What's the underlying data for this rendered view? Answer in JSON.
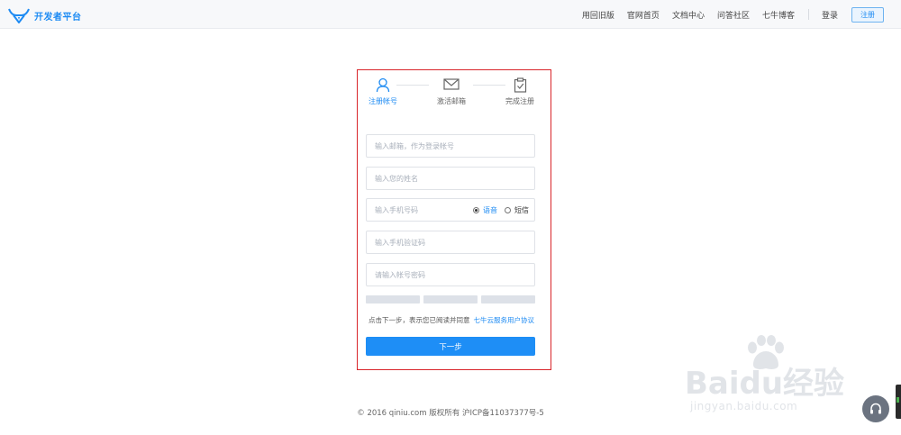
{
  "brand": {
    "name": "开发者平台",
    "color": "#1e8bf3"
  },
  "nav": {
    "items": [
      "用回旧版",
      "官网首页",
      "文档中心",
      "问答社区",
      "七牛博客"
    ],
    "login": "登录",
    "register": "注册"
  },
  "steps": [
    {
      "label": "注册帐号",
      "icon": "user-icon",
      "active": true
    },
    {
      "label": "激活邮箱",
      "icon": "mail-icon",
      "active": false
    },
    {
      "label": "完成注册",
      "icon": "clipboard-check-icon",
      "active": false
    }
  ],
  "form": {
    "email_placeholder": "输入邮箱，作为登录帐号",
    "name_placeholder": "输入您的姓名",
    "phone_placeholder": "输入手机号码",
    "verify_method": {
      "options": [
        "语音",
        "短信"
      ],
      "selected": "语音"
    },
    "code_placeholder": "输入手机验证码",
    "password_placeholder": "请输入帐号密码",
    "agree_text": "点击下一步，表示您已阅读并同意",
    "agree_link": "七牛云服务用户协议",
    "next_button": "下一步"
  },
  "footer": {
    "text": "© 2016 qiniu.com 版权所有 沪ICP备11037377号-5"
  },
  "watermark": {
    "main": "Baidu经验",
    "sub": "jingyan.baidu.com"
  },
  "colors": {
    "accent": "#1e8ef6",
    "highlight_border": "#d9252a",
    "header_bg": "#f7f8fa"
  }
}
